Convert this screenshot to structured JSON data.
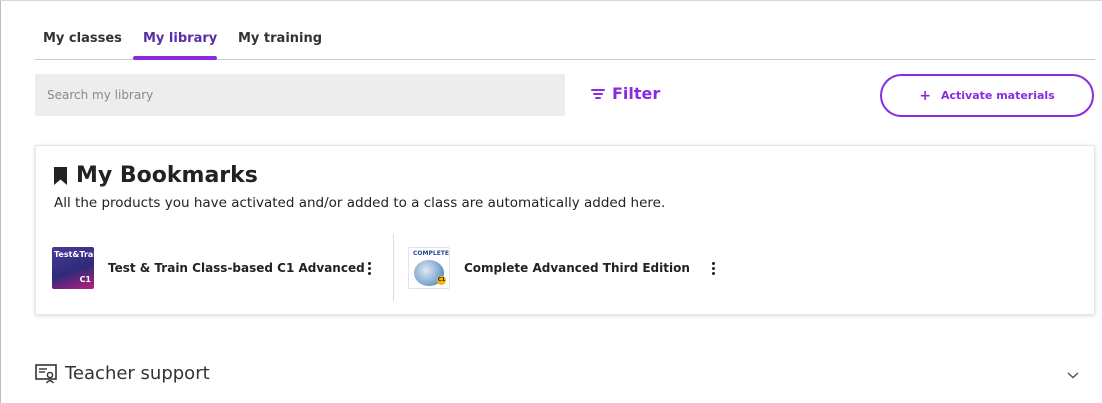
{
  "tabs": [
    {
      "label": "My classes"
    },
    {
      "label": "My library",
      "active": true
    },
    {
      "label": "My training"
    }
  ],
  "toolbar": {
    "search_placeholder": "Search my library",
    "filter_label": "Filter",
    "activate_plus": "+",
    "activate_label": "Activate materials"
  },
  "bookmarks": {
    "title": "My Bookmarks",
    "subtitle": "All the products you have activated and/or added to a class are automatically added here.",
    "products": [
      {
        "name": "Test & Train Class-based C1 Advanced",
        "cover_text": "Test&Train",
        "cover_level": "C1"
      },
      {
        "name": "Complete Advanced Third Edition",
        "cover_text": "COMPLETE",
        "cover_level": "C1"
      }
    ]
  },
  "teacher_support": {
    "label": "Teacher support"
  },
  "colors": {
    "accent": "#8a2be2",
    "active_tab_text": "#5a2ea6",
    "search_bg": "#ededed"
  },
  "icons": {
    "bookmark": "bookmark-icon",
    "filter": "filter-icon",
    "more": "kebab-menu-icon",
    "support": "presentation-board-icon",
    "expand": "chevron-down-icon"
  }
}
